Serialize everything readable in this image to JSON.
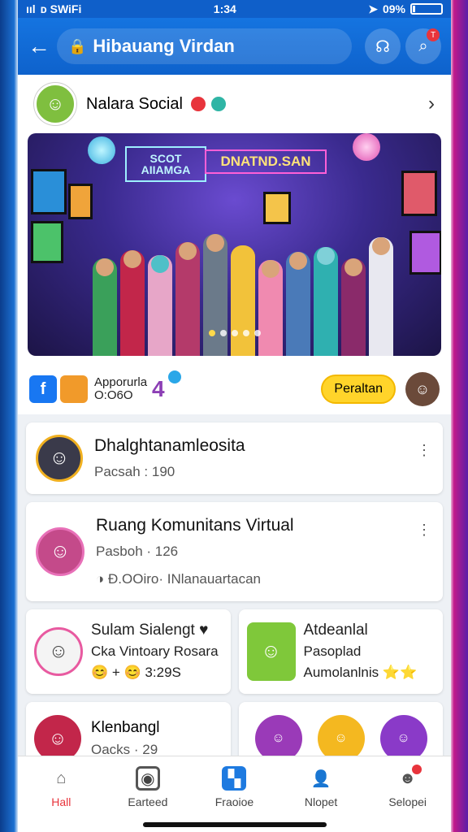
{
  "status": {
    "carrier": "ııl",
    "network": "ᴅ SWiFi",
    "time": "1:34",
    "battery": "09%",
    "battery_level": 0.09
  },
  "header": {
    "back_icon": "arrow-left-icon",
    "lock_icon": "lock-icon",
    "title": "Hibauang Virdan",
    "notif_badge": "T"
  },
  "profile": {
    "name": "Nalara Social",
    "avatar_color": "#7fbf3f"
  },
  "banner": {
    "sign_left": "SCOT AIIAMGA",
    "sign_right": "DNATND.SAN",
    "pager_count": 5,
    "pager_active": 0
  },
  "share": {
    "fb_label": "f",
    "line1": "Apporurla",
    "line2": "O:O6O",
    "count": "4",
    "button_label": "Peraltan"
  },
  "list": [
    {
      "title": "Dhalghtanamleosita",
      "subtitle": "Pacsah : 190",
      "extra": ""
    },
    {
      "title": "Ruang Komunitans Virtual",
      "subtitle": "Pasboh · 126",
      "extra": "◑ Ð.OOiro· INlanauartacan"
    }
  ],
  "grid": [
    {
      "title": "Sulam Sialengt ♥",
      "line2": "Cka Vintoary Rosara",
      "line3": "😊 + 😊 3:29S"
    },
    {
      "title": "Atdeanlal",
      "line2": "Pasoplad",
      "line3": "Aumolanlnis ⭐⭐"
    }
  ],
  "bottom_card": {
    "title": "Klenbangl",
    "line2": "Oacks · 29"
  },
  "tabs": [
    {
      "label": "Hall",
      "icon": "home-icon"
    },
    {
      "label": "Earteed",
      "icon": "instagram-icon"
    },
    {
      "label": "Fraoioe",
      "icon": "puzzle-icon"
    },
    {
      "label": "Nlopet",
      "icon": "person-icon"
    },
    {
      "label": "Selopei",
      "icon": "profile-icon"
    }
  ],
  "colors": {
    "primary": "#0f5fc9",
    "accent": "#e8343c",
    "button_yellow": "#ffd42a"
  }
}
